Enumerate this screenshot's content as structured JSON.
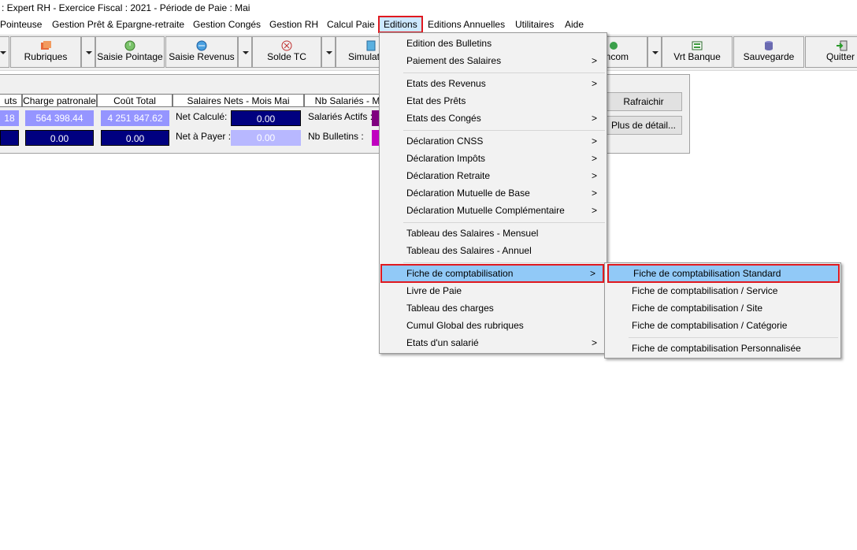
{
  "title": ": Expert RH - Exercice Fiscal : 2021 - Période de Paie : Mai",
  "menubar": [
    {
      "label": "Pointeuse"
    },
    {
      "label": "Gestion Prêt & Epargne-retraite"
    },
    {
      "label": "Gestion Congés"
    },
    {
      "label": "Gestion RH"
    },
    {
      "label": "Calcul Paie"
    },
    {
      "label": "Editions"
    },
    {
      "label": "Editions Annuelles"
    },
    {
      "label": "Utilitaires"
    },
    {
      "label": "Aide"
    }
  ],
  "toolbar": {
    "rubriques": "Rubriques",
    "saisie_pointage": "Saisie Pointage",
    "saisie_revenus": "Saisie Revenus",
    "solde_tc": "Solde TC",
    "simulation": "Simulati",
    "bancom": "ancom",
    "vrt_banque": "Vrt Banque",
    "sauvegarde": "Sauvegarde",
    "quitter": "Quitter"
  },
  "summary": {
    "headers": {
      "col0": "uts",
      "col1": "Charge patronale",
      "col2": "Coût Total",
      "col3": "Salaires Nets - Mois Mai",
      "col4": "Nb Salariés - M"
    },
    "row1": {
      "c0": "18",
      "c1": "564 398.44",
      "c2": "4 251 847.62",
      "net_label": "Net Calculé:",
      "net_value": "0.00",
      "sal_label": "Salariés Actifs :"
    },
    "row2": {
      "c1": "0.00",
      "c2": "0.00",
      "pay_label": "Net à Payer :",
      "pay_value": "0.00",
      "bul_label": "Nb Bulletins :"
    },
    "rafraichir": "Rafraichir",
    "plus_detail": "Plus de détail..."
  },
  "editions_menu": [
    {
      "label": "Edition des Bulletins",
      "arrow": ""
    },
    {
      "label": "Paiement des Salaires",
      "arrow": ">"
    },
    {
      "label": "Etats des Revenus",
      "arrow": ">"
    },
    {
      "label": "Etat des Prêts",
      "arrow": ""
    },
    {
      "label": "Etats des Congés",
      "arrow": ">"
    },
    {
      "label": "Déclaration CNSS",
      "arrow": ">"
    },
    {
      "label": "Déclaration Impôts",
      "arrow": ">"
    },
    {
      "label": "Déclaration Retraite",
      "arrow": ">"
    },
    {
      "label": "Déclaration Mutuelle de Base",
      "arrow": ">"
    },
    {
      "label": "Déclaration Mutuelle Complémentaire",
      "arrow": ">"
    },
    {
      "label": "Tableau des Salaires - Mensuel",
      "arrow": ""
    },
    {
      "label": "Tableau des Salaires - Annuel",
      "arrow": ""
    },
    {
      "label": "Fiche de comptabilisation",
      "arrow": ">"
    },
    {
      "label": "Livre de Paie",
      "arrow": ""
    },
    {
      "label": "Tableau des charges",
      "arrow": ""
    },
    {
      "label": "Cumul Global des rubriques",
      "arrow": ""
    },
    {
      "label": "Etats d'un salarié",
      "arrow": ">"
    }
  ],
  "submenu": [
    {
      "label": "Fiche de comptabilisation Standard"
    },
    {
      "label": "Fiche de comptabilisation / Service"
    },
    {
      "label": "Fiche de comptabilisation / Site"
    },
    {
      "label": "Fiche de comptabilisation / Catégorie"
    },
    {
      "label": "Fiche de comptabilisation Personnalisée"
    }
  ],
  "colors": {
    "accent_red": "#e0191f",
    "highlight": "#91c9f7",
    "navy": "#000080",
    "lavender": "#9595ff",
    "purple": "#800080",
    "magenta": "#c000c0"
  }
}
